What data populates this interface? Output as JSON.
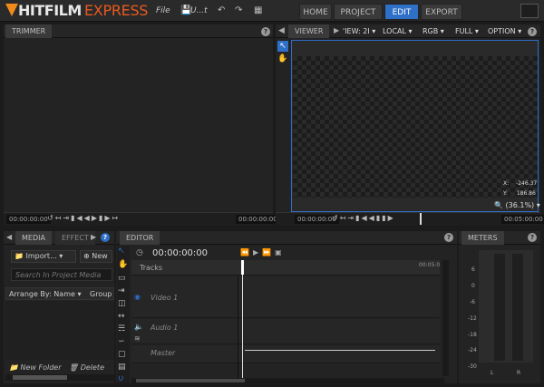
{
  "app": {
    "logo_main": "HITFILM",
    "logo_accent": "EXPRESS"
  },
  "menu": {
    "file": "File",
    "project_name": "U...t"
  },
  "nav_tabs": [
    {
      "label": "HOME"
    },
    {
      "label": "PROJECT"
    },
    {
      "label": "EDIT",
      "active": true
    },
    {
      "label": "EXPORT"
    }
  ],
  "trimmer": {
    "title": "TRIMMER",
    "timecode_left": "00:00:00:00",
    "timecode_right": "00:00:00:00"
  },
  "viewer": {
    "title": "VIEWER",
    "view_dropdown": "'IEW: 2I",
    "space_dropdown": "LOCAL",
    "color_dropdown": "RGB",
    "quality_dropdown": "FULL",
    "options_dropdown": "OPTION",
    "coord_x_label": "X:",
    "coord_x": "-246.37",
    "coord_y_label": "Y:",
    "coord_y": "186.86",
    "zoom": "(36.1%)",
    "timecode_left": "00:00:00:00",
    "timecode_right": "00:05:00:00"
  },
  "media": {
    "tab_media": "MEDIA",
    "tab_effects": "EFFECT",
    "import_label": "Import...",
    "new_label": "New",
    "search_placeholder": "Search In Project Media",
    "arrange_label": "Arrange By: Name",
    "group_label": "Group",
    "new_folder_label": "New Folder",
    "delete_label": "Delete"
  },
  "editor": {
    "title": "EDITOR",
    "timecode": "00:00:00:00",
    "tracks_label": "Tracks",
    "ruler_mark": "00:05:0",
    "tracks": [
      {
        "name": "Video 1"
      },
      {
        "name": "Audio 1"
      },
      {
        "name": "Master"
      }
    ]
  },
  "meters": {
    "title": "METERS",
    "scale": [
      "6",
      "0",
      "-6",
      "-12",
      "-18",
      "-24",
      "-30"
    ],
    "left": "L",
    "right": "R"
  },
  "colors": {
    "accent": "#2e6fc8",
    "brand_orange": "#e85a1f"
  }
}
